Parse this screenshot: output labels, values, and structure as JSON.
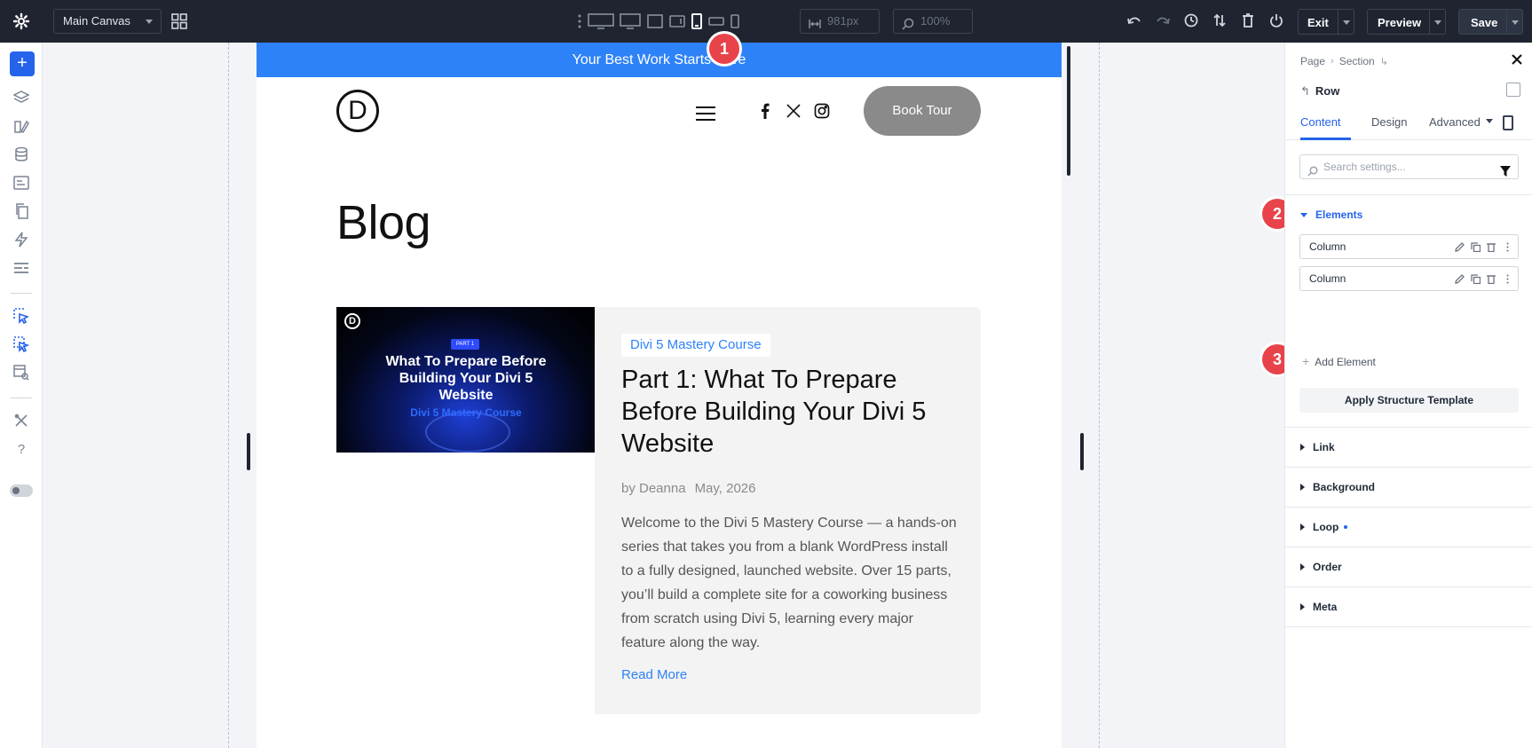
{
  "topbar": {
    "canvas_select": "Main Canvas",
    "width_value": "981px",
    "zoom_value": "100%",
    "exit_label": "Exit",
    "preview_label": "Preview",
    "save_label": "Save"
  },
  "page": {
    "promo_text": "Your Best Work Starts Here",
    "logo_letter": "D",
    "book_button": "Book Tour",
    "blog_title": "Blog",
    "post": {
      "image_part": "PART 1",
      "image_title": "What To Prepare Before Building Your Divi 5 Website",
      "image_subtitle": "Divi 5 Mastery Course",
      "category": "Divi 5 Mastery Course",
      "title": "Part 1: What To Prepare Before Building Your Divi 5 Website",
      "author": "by Deanna",
      "date": "May, 2026",
      "excerpt": "Welcome to the Divi 5 Mastery Course — a hands-on series that takes you from a blank WordPress install to a fully designed, launched website. Over 15 parts, you’ll build a complete site for a coworking business from scratch using Divi 5, learning every major feature along the way.",
      "read_more": "Read More"
    }
  },
  "badges": [
    "1",
    "2",
    "3"
  ],
  "panel": {
    "breadcrumb": [
      "Page",
      "Section"
    ],
    "row_label": "Row",
    "tabs": [
      "Content",
      "Design",
      "Advanced"
    ],
    "search_placeholder": "Search settings...",
    "elements_group": "Elements",
    "elements": [
      "Column",
      "Column"
    ],
    "add_element": "Add Element",
    "apply_template": "Apply Structure Template",
    "groups": [
      "Link",
      "Background",
      "Loop",
      "Order",
      "Meta"
    ]
  },
  "colors": {
    "accent": "#2563eb",
    "promo_bar": "#2e82f7",
    "badge": "#e8434a",
    "topbar": "#1f2430"
  }
}
